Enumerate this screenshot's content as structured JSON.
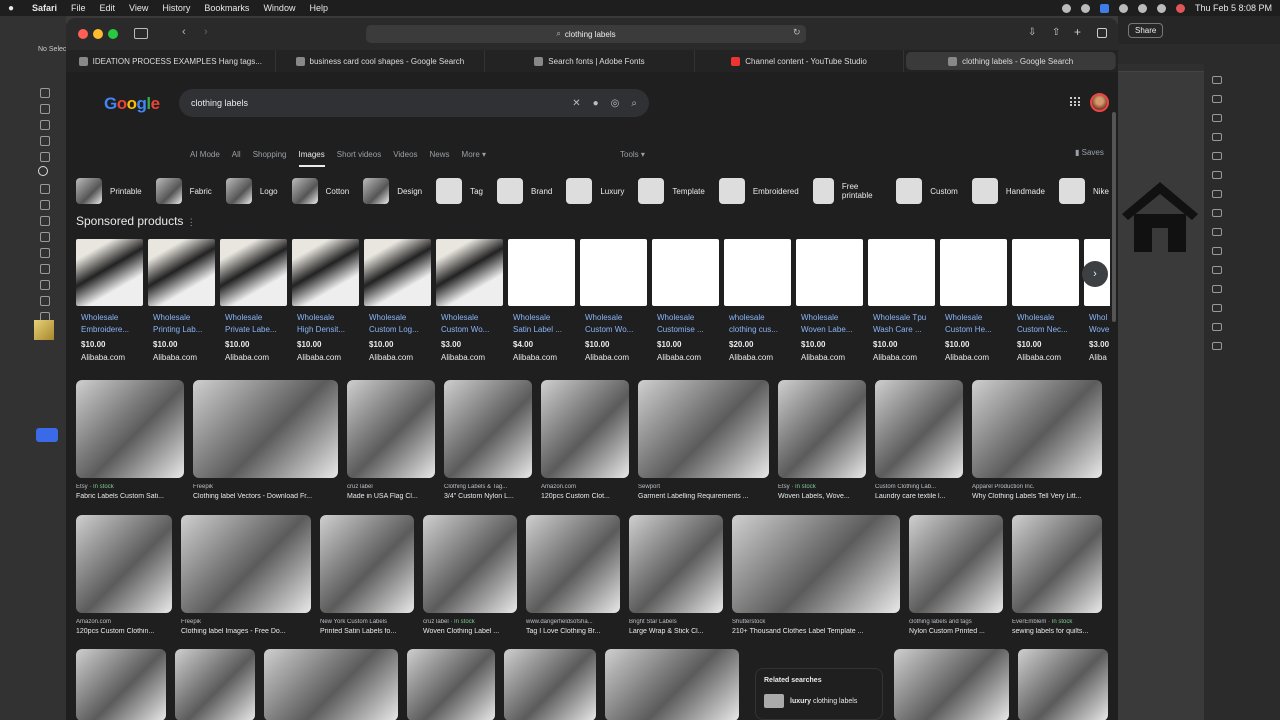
{
  "menubar": {
    "items": [
      "Safari",
      "File",
      "Edit",
      "View",
      "History",
      "Bookmarks",
      "Window",
      "Help"
    ],
    "clock": "Thu Feb 5  8:08 PM"
  },
  "illustrator": {
    "no_selection": "No Selec",
    "share": "Share"
  },
  "browser": {
    "address": "clothing labels",
    "tabs": [
      "IDEATION PROCESS EXAMPLES Hang tags...",
      "business card cool shapes - Google Search",
      "Search fonts | Adobe Fonts",
      "Channel content - YouTube Studio",
      "clothing labels - Google Search"
    ]
  },
  "google": {
    "logo": "Google",
    "query": "clothing labels",
    "nav": [
      "AI Mode",
      "All",
      "Shopping",
      "Images",
      "Short videos",
      "Videos",
      "News",
      "More ▾"
    ],
    "tools": "Tools ▾",
    "saves": "Saves",
    "chips": [
      "Printable",
      "Fabric",
      "Logo",
      "Cotton",
      "Design",
      "Tag",
      "Brand",
      "Luxury",
      "Template",
      "Embroidered",
      "Free printable",
      "Custom",
      "Handmade",
      "Nike"
    ],
    "sponsored_title": "Sponsored products",
    "products": [
      {
        "t1": "Wholesale",
        "t2": "Embroidere...",
        "price": "$10.00",
        "store": "Alibaba.com"
      },
      {
        "t1": "Wholesale",
        "t2": "Printing Lab...",
        "price": "$10.00",
        "store": "Alibaba.com"
      },
      {
        "t1": "Wholesale",
        "t2": "Private Labe...",
        "price": "$10.00",
        "store": "Alibaba.com"
      },
      {
        "t1": "Wholesale",
        "t2": "High Densit...",
        "price": "$10.00",
        "store": "Alibaba.com"
      },
      {
        "t1": "Wholesale",
        "t2": "Custom Log...",
        "price": "$10.00",
        "store": "Alibaba.com"
      },
      {
        "t1": "Wholesale",
        "t2": "Custom Wo...",
        "price": "$3.00",
        "store": "Alibaba.com"
      },
      {
        "t1": "Wholesale",
        "t2": "Satin Label ...",
        "price": "$4.00",
        "store": "Alibaba.com"
      },
      {
        "t1": "Wholesale",
        "t2": "Custom Wo...",
        "price": "$10.00",
        "store": "Alibaba.com"
      },
      {
        "t1": "Wholesale",
        "t2": "Customise ...",
        "price": "$10.00",
        "store": "Alibaba.com"
      },
      {
        "t1": "wholesale",
        "t2": "clothing cus...",
        "price": "$20.00",
        "store": "Alibaba.com"
      },
      {
        "t1": "Wholesale",
        "t2": "Woven Labe...",
        "price": "$10.00",
        "store": "Alibaba.com"
      },
      {
        "t1": "Wholesale Tpu",
        "t2": "Wash Care ...",
        "price": "$10.00",
        "store": "Alibaba.com"
      },
      {
        "t1": "Wholesale",
        "t2": "Custom He...",
        "price": "$10.00",
        "store": "Alibaba.com"
      },
      {
        "t1": "Wholesale",
        "t2": "Custom Nec...",
        "price": "$10.00",
        "store": "Alibaba.com"
      },
      {
        "t1": "Whol",
        "t2": "Wove",
        "price": "$3.00",
        "store": "Aliba"
      }
    ],
    "row1": [
      {
        "src": "Etsy · ",
        "stock": "In stock",
        "title": "Fabric Labels Custom Sati..."
      },
      {
        "src": "Freepik",
        "stock": "",
        "title": "Clothing label Vectors - Download Fr..."
      },
      {
        "src": "cruz label",
        "stock": "",
        "title": "Made in USA Flag Cl..."
      },
      {
        "src": "Clothing Labels & Tag...",
        "stock": "",
        "title": "3/4\" Custom Nylon L..."
      },
      {
        "src": "Amazon.com",
        "stock": "",
        "title": "120pcs Custom Clot..."
      },
      {
        "src": "Sewport",
        "stock": "",
        "title": "Garment Labelling Requirements ..."
      },
      {
        "src": "Etsy · ",
        "stock": "In stock",
        "title": "Woven Labels, Wove..."
      },
      {
        "src": "Custom Clothing Lab...",
        "stock": "",
        "title": "Laundry care textile l..."
      },
      {
        "src": "Apparel Production Inc.",
        "stock": "",
        "title": "Why Clothing Labels Tell Very Litt..."
      }
    ],
    "row2": [
      {
        "src": "Amazon.com",
        "stock": "",
        "title": "120pcs Custom Clothin..."
      },
      {
        "src": "Freepik",
        "stock": "",
        "title": "Clothing label Images - Free Do..."
      },
      {
        "src": "New York Custom Labels",
        "stock": "",
        "title": "Printed Satin Labels fo..."
      },
      {
        "src": "cruz label · ",
        "stock": "In stock",
        "title": "Woven Clothing Label ..."
      },
      {
        "src": "www.dangerfieldsofsha...",
        "stock": "",
        "title": "Tag I Love Clothing Br..."
      },
      {
        "src": "Bright Star Labels",
        "stock": "",
        "title": "Large Wrap & Stick Cl..."
      },
      {
        "src": "Shutterstock",
        "stock": "",
        "title": "210+ Thousand Clothes Label Template ..."
      },
      {
        "src": "clothing labels and tags",
        "stock": "",
        "title": "Nylon Custom Printed ..."
      },
      {
        "src": "EverEmblem · ",
        "stock": "In stock",
        "title": "sewing labels for quilts..."
      }
    ],
    "related": {
      "title": "Related searches",
      "item_bold": "luxury",
      "item_rest": " clothing labels"
    }
  }
}
